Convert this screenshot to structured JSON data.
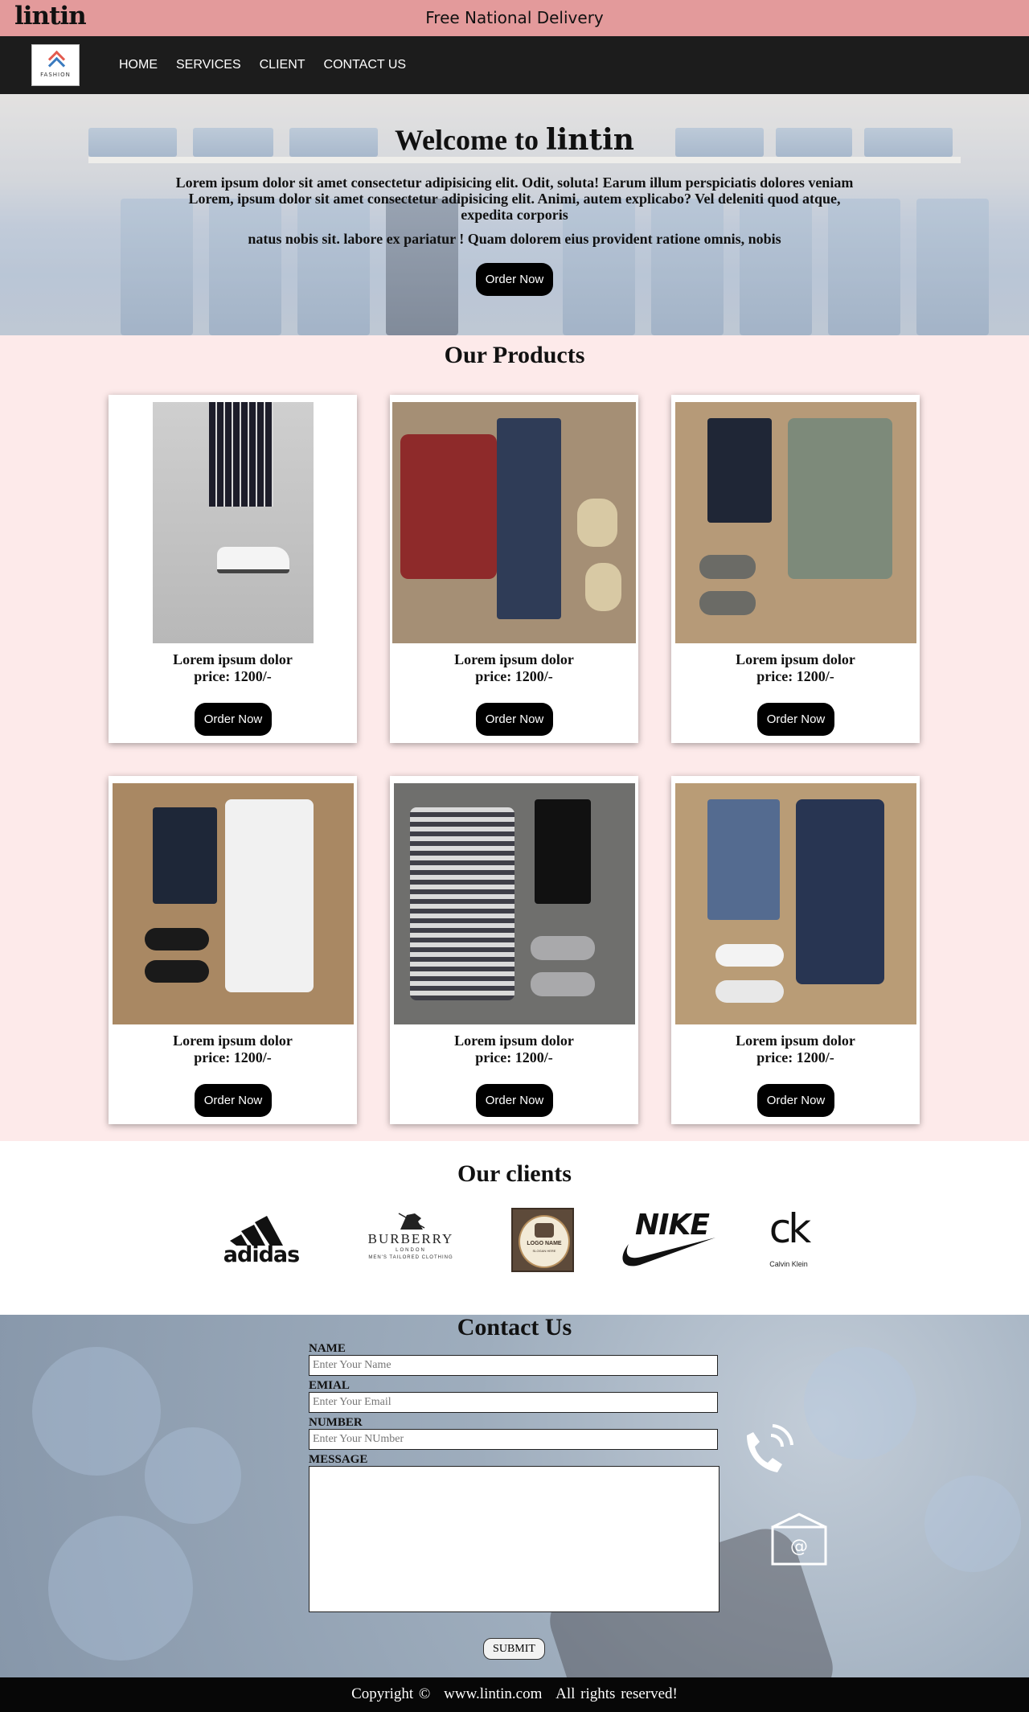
{
  "topbar": {
    "brand": "lintin",
    "tagline": "Free National Delivery"
  },
  "nav": {
    "logo_text": "FASHION",
    "items": [
      {
        "label": "HOME"
      },
      {
        "label": "SERVICES"
      },
      {
        "label": "CLIENT"
      },
      {
        "label": "CONTACT US"
      }
    ]
  },
  "hero": {
    "title_prefix": "Welcome to",
    "title_brand": "lintin",
    "text": "Lorem ipsum dolor sit amet consectetur adipisicing elit. Odit, soluta! Earum illum perspiciatis dolores veniam Lorem, ipsum dolor sit amet consectetur adipisicing elit. Animi, autem explicabo? Vel deleniti quod atque, expedita corporis",
    "text2": "natus nobis sit. labore ex pariatur ! Quam dolorem eius provident ratione omnis, nobis",
    "cta": "Order Now"
  },
  "products": {
    "title": "Our Products",
    "items": [
      {
        "name": "Lorem ipsum dolor",
        "price": "price: 1200/-",
        "cta": "Order Now",
        "image": "sneakers-legs-photo"
      },
      {
        "name": "Lorem ipsum dolor",
        "price": "price: 1200/-",
        "cta": "Order Now",
        "image": "red-sweater-outfit-photo"
      },
      {
        "name": "Lorem ipsum dolor",
        "price": "price: 1200/-",
        "cta": "Order Now",
        "image": "green-shirt-outfit-photo"
      },
      {
        "name": "Lorem ipsum dolor",
        "price": "price: 1200/-",
        "cta": "Order Now",
        "image": "white-shirt-outfit-photo"
      },
      {
        "name": "Lorem ipsum dolor",
        "price": "price: 1200/-",
        "cta": "Order Now",
        "image": "checked-shirt-outfit-photo"
      },
      {
        "name": "Lorem ipsum dolor",
        "price": "price: 1200/-",
        "cta": "Order Now",
        "image": "navy-sweater-outfit-photo"
      }
    ]
  },
  "clients": {
    "title": "Our clients",
    "logos": [
      "adidas",
      "BURBERRY",
      "LOGO NAME",
      "NIKE",
      "ck"
    ],
    "burberry_sub": "LONDON",
    "burberry_sub2": "MEN'S TAILORED CLOTHING",
    "logo_name_sub": "SLOGAN HERE",
    "ck_sub": "Calvin Klein"
  },
  "contact": {
    "title": "Contact Us",
    "fields": [
      {
        "label": "NAME",
        "placeholder": "Enter Your Name"
      },
      {
        "label": "EMIAL",
        "placeholder": "Enter Your Email"
      },
      {
        "label": "NUMBER",
        "placeholder": "Enter Your NUmber"
      },
      {
        "label": "MESSAGE",
        "placeholder": ""
      }
    ],
    "submit": "SUBMIT"
  },
  "footer": {
    "copyright": "Copyright ©",
    "site": "www.lintin.com",
    "rights": "All rights reserved!"
  },
  "colors": {
    "topbar": "#e39a9b",
    "nav": "#1c1c1c",
    "products_bg": "#fdeaea",
    "button": "#000000"
  }
}
